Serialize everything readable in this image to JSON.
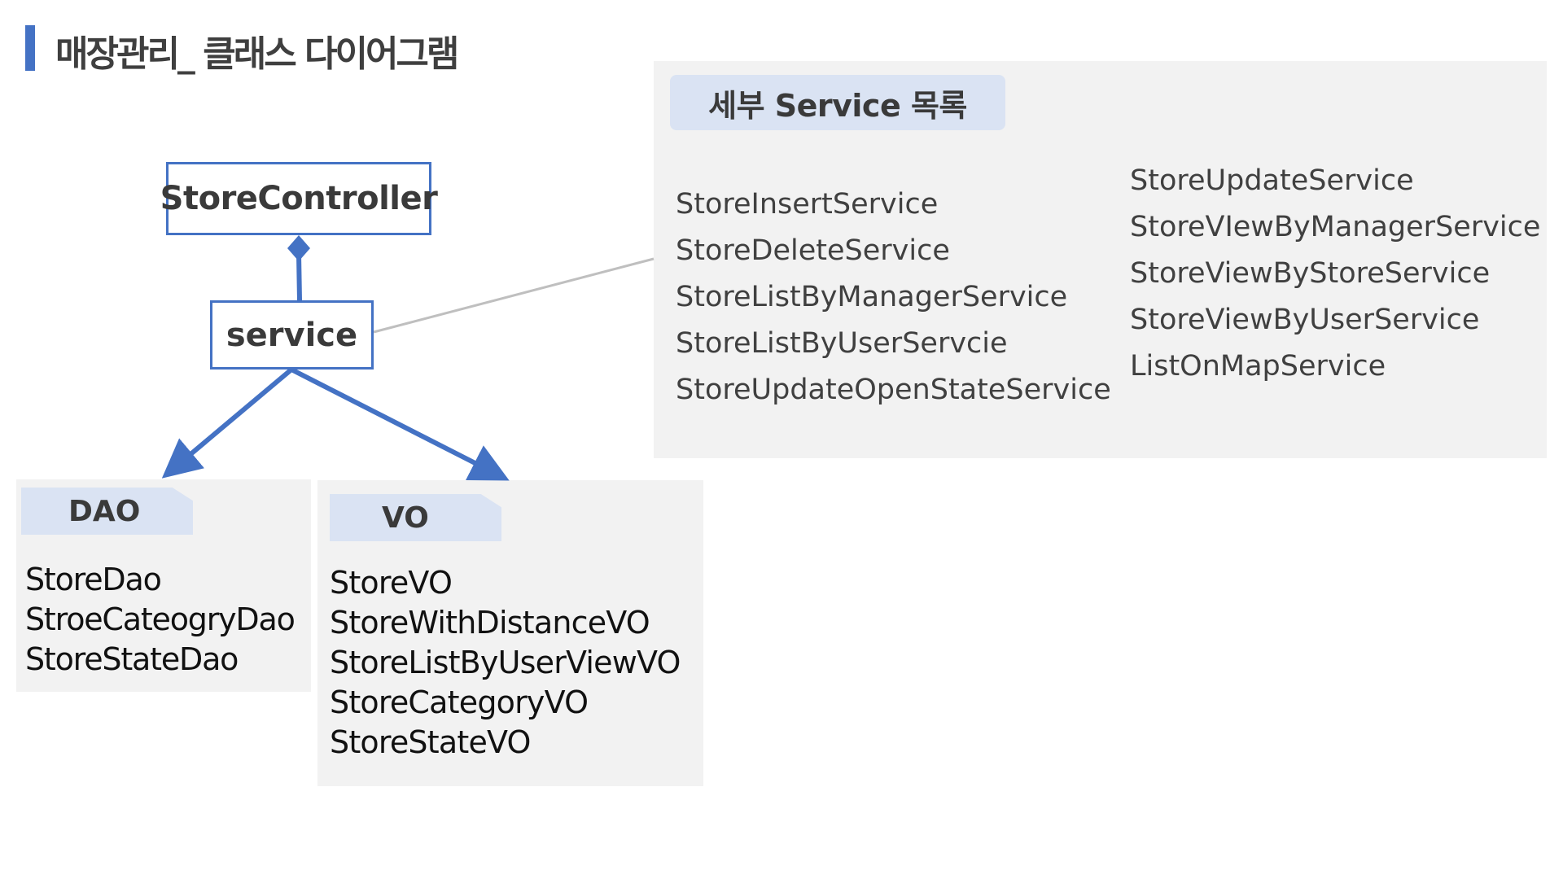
{
  "title": "매장관리_ 클래스 다이어그램",
  "colors": {
    "accent": "#4472c4",
    "panel": "#f2f2f2",
    "tab": "#dae3f3",
    "connector": "#bfbfbf"
  },
  "diagram": {
    "controller": "StoreController",
    "service": "service"
  },
  "services_panel": {
    "header": "세부 Service 목록",
    "column1": [
      "StoreInsertService",
      "StoreDeleteService",
      "StoreListByManagerService",
      "StoreListByUserServcie",
      "StoreUpdateOpenStateService"
    ],
    "column2": [
      "StoreUpdateService",
      "StoreVIewByManagerService",
      "StoreViewByStoreService",
      "StoreViewByUserService",
      "ListOnMapService"
    ]
  },
  "dao_panel": {
    "header": "DAO",
    "items": [
      "StoreDao",
      "StroeCateogryDao",
      "StoreStateDao"
    ]
  },
  "vo_panel": {
    "header": "VO",
    "items": [
      "StoreVO",
      "StoreWithDistanceVO",
      "StoreListByUserViewVO",
      "StoreCategoryVO",
      "StoreStateVO"
    ]
  }
}
